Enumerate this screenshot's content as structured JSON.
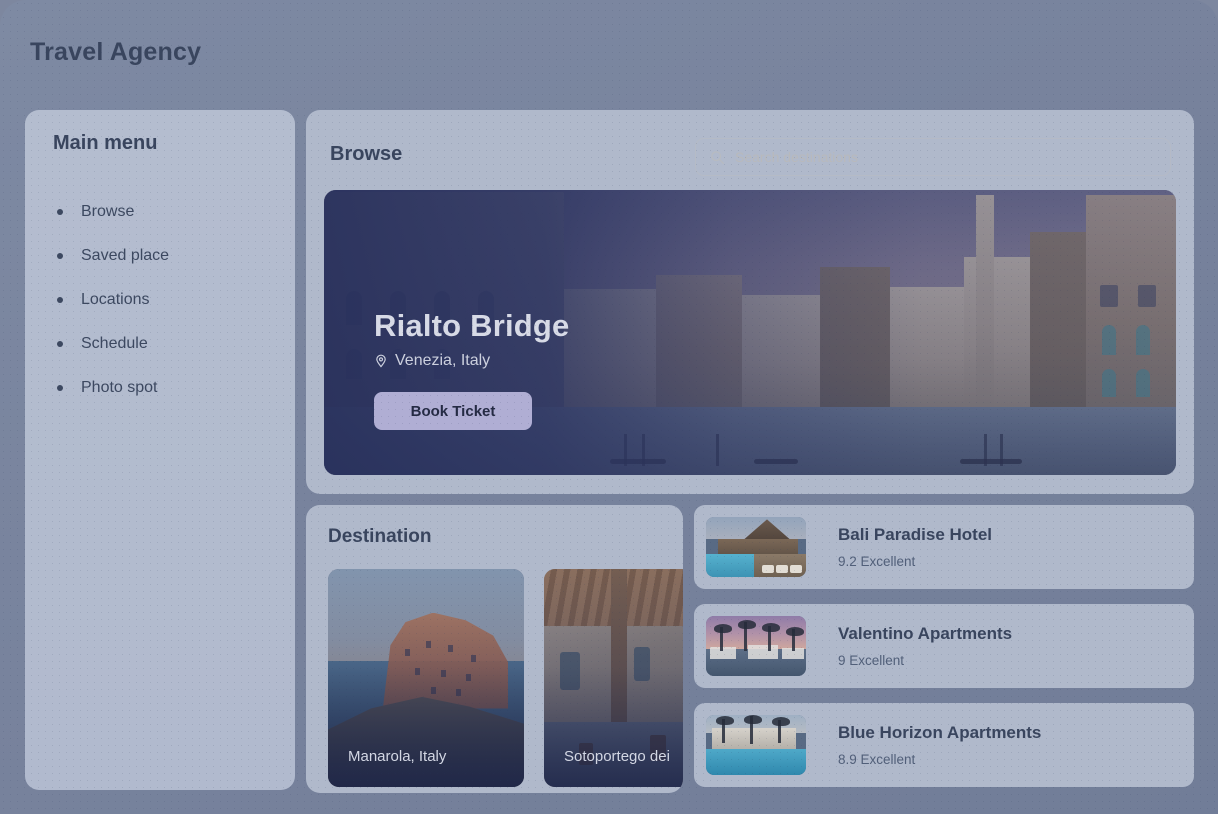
{
  "app": {
    "title": "Travel Agency"
  },
  "sidebar": {
    "title": "Main menu",
    "items": [
      {
        "label": "Browse"
      },
      {
        "label": "Saved place"
      },
      {
        "label": "Locations"
      },
      {
        "label": "Schedule"
      },
      {
        "label": "Photo spot"
      }
    ]
  },
  "browse": {
    "title": "Browse",
    "search": {
      "icon": "search-icon",
      "placeholder": "Search destinations",
      "value": ""
    },
    "hero": {
      "heading": "Rialto Bridge",
      "location": "Venezia, Italy",
      "location_icon": "map-pin-icon",
      "button_label": "Book Ticket"
    }
  },
  "destination": {
    "title": "Destination",
    "cards": [
      {
        "caption": "Manarola, Italy"
      },
      {
        "caption": "Sotoportego dei"
      }
    ]
  },
  "hotels": [
    {
      "name": "Bali Paradise Hotel",
      "rating": "9.2 Excellent"
    },
    {
      "name": "Valentino Apartments",
      "rating": "9 Excellent"
    },
    {
      "name": "Blue Horizon Apartments",
      "rating": "8.9 Excellent"
    }
  ],
  "colors": {
    "window_bg": "#7b8600",
    "panel": "#b0b9cb",
    "sidebar": "#b4bdcf",
    "text_dark": "#39455e",
    "text_muted": "#515f79",
    "hero_overlay": "#2e3662",
    "accent_button": "#b0aed4",
    "accent_button_text": "#252b44",
    "hero_heading": "#d7dae6"
  }
}
